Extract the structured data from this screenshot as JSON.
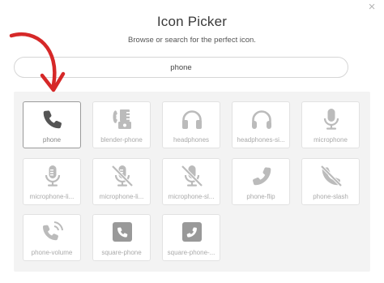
{
  "dialog": {
    "title": "Icon Picker",
    "subtitle": "Browse or search for the perfect icon.",
    "close_icon": "×"
  },
  "search": {
    "value": "phone",
    "placeholder": ""
  },
  "accent_color": "#d62828",
  "icons": [
    {
      "label": "phone",
      "icon": "phone-icon",
      "selected": true
    },
    {
      "label": "blender-phone",
      "icon": "blender-phone-icon"
    },
    {
      "label": "headphones",
      "icon": "headphones-icon"
    },
    {
      "label": "headphones-si...",
      "icon": "headphones-simple-icon"
    },
    {
      "label": "microphone",
      "icon": "microphone-icon"
    },
    {
      "label": "microphone-li...",
      "icon": "microphone-lines-icon"
    },
    {
      "label": "microphone-li...",
      "icon": "microphone-lines-slash-icon"
    },
    {
      "label": "microphone-sl...",
      "icon": "microphone-slash-icon"
    },
    {
      "label": "phone-flip",
      "icon": "phone-flip-icon"
    },
    {
      "label": "phone-slash",
      "icon": "phone-slash-icon"
    },
    {
      "label": "phone-volume",
      "icon": "phone-volume-icon"
    },
    {
      "label": "square-phone",
      "icon": "square-phone-icon"
    },
    {
      "label": "square-phone-...",
      "icon": "square-phone-flip-icon"
    }
  ]
}
